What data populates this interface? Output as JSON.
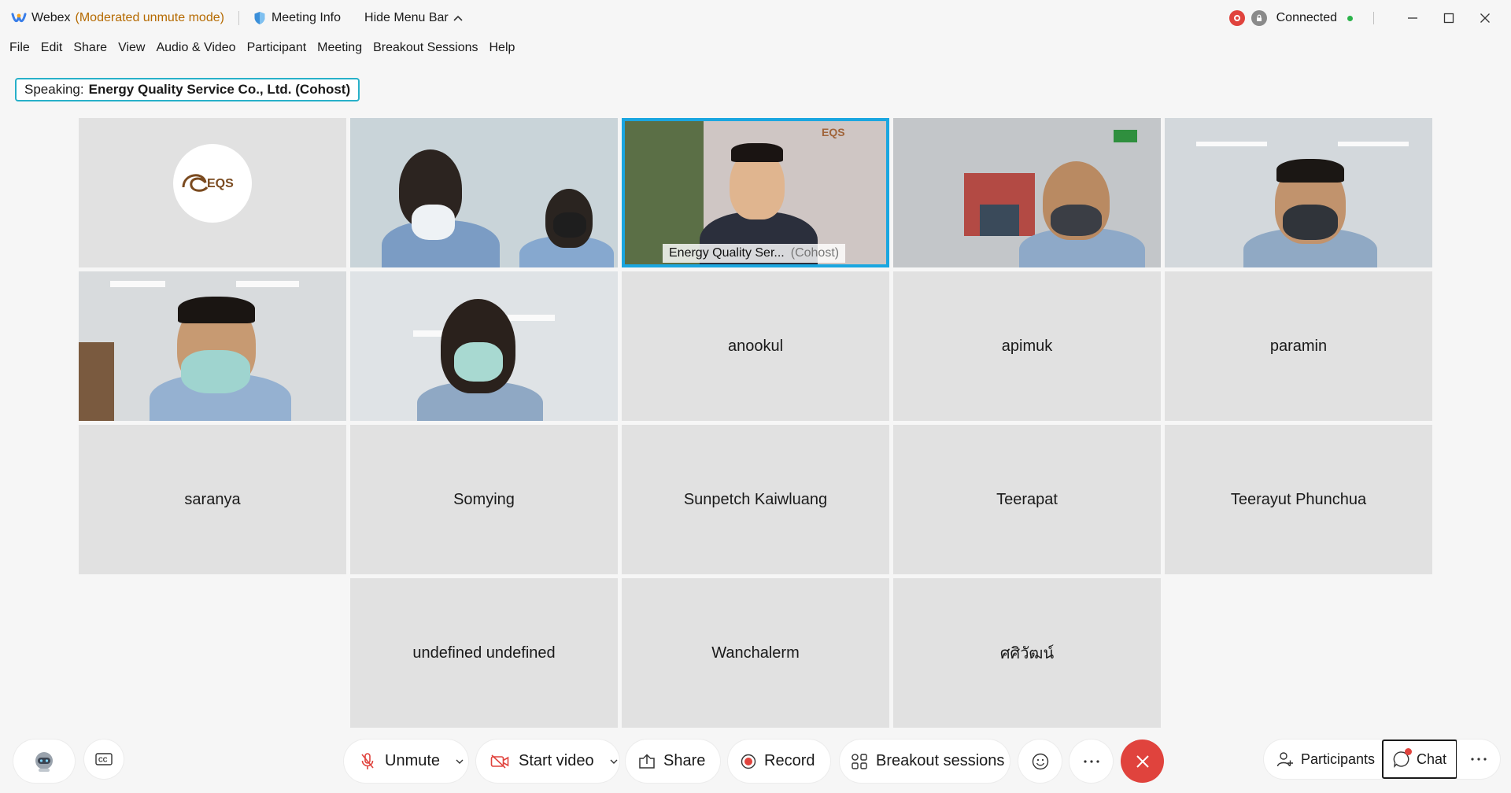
{
  "titlebar": {
    "app_name": "Webex",
    "mode": "(Moderated unmute mode)",
    "meeting_info": "Meeting Info",
    "hide_menu": "Hide Menu Bar",
    "status": "Connected"
  },
  "menu": [
    "File",
    "Edit",
    "Share",
    "View",
    "Audio & Video",
    "Participant",
    "Meeting",
    "Breakout Sessions",
    "Help"
  ],
  "speaking": {
    "label": "Speaking:",
    "name": "Energy Quality Service Co., Ltd. (Cohost)"
  },
  "tiles": {
    "active_name": "Energy Quality Ser...",
    "active_role": "(Cohost)",
    "names": [
      "anookul",
      "apimuk",
      "paramin",
      "saranya",
      "Somying",
      "Sunpetch Kaiwluang",
      "Teerapat",
      "Teerayut Phunchua",
      "undefined undefined",
      "Wanchalerm",
      "ศศิวัฒน์"
    ]
  },
  "controls": {
    "unmute": "Unmute",
    "start_video": "Start video",
    "share": "Share",
    "record": "Record",
    "breakout": "Breakout sessions",
    "participants": "Participants",
    "chat": "Chat"
  },
  "colors": {
    "accent": "#1aa6e0",
    "end_call": "#e0433d",
    "mode_text": "#b56a00",
    "connected_dot": "#2bb34a"
  }
}
